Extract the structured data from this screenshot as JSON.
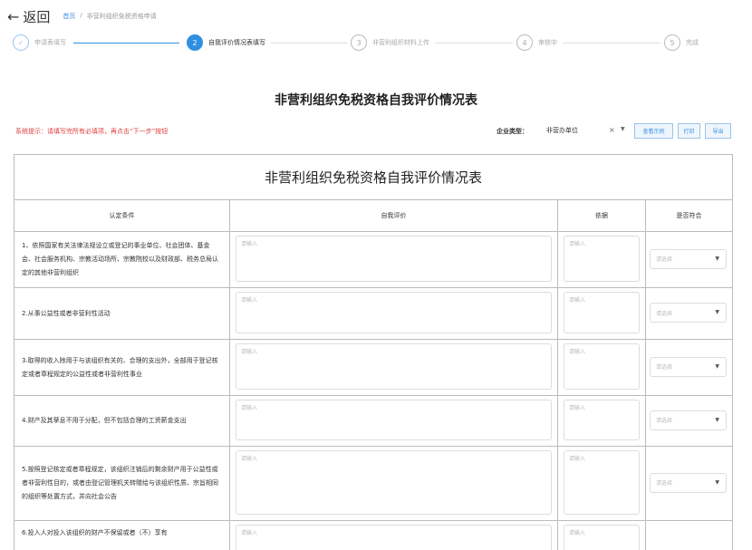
{
  "topbar": {
    "back_label": "返回",
    "breadcrumb": [
      "首页",
      "/",
      "非营利组织免税资格申请"
    ]
  },
  "steps": [
    {
      "num": "✓",
      "label": "申请表填写",
      "state": "done"
    },
    {
      "num": "2",
      "label": "自我评价情况表填写",
      "state": "active"
    },
    {
      "num": "3",
      "label": "非营利组织材料上传",
      "state": "todo"
    },
    {
      "num": "4",
      "label": "审核中",
      "state": "todo"
    },
    {
      "num": "5",
      "label": "完成",
      "state": "todo"
    }
  ],
  "page_title": "非营利组织免税资格自我评价情况表",
  "toolbar": {
    "hint": "系统提示：请填写完所有必填项，再点击“下一步”按钮",
    "type_label": "企业类型：",
    "type_value": "非营办单位",
    "btn_sample": "查看示例",
    "btn_print": "打印",
    "btn_export": "导出"
  },
  "table": {
    "title": "非营利组织免税资格自我评价情况表",
    "headers": [
      "认定条件",
      "自我评价",
      "依据",
      "是否符合"
    ],
    "placeholder": "请输入",
    "select_placeholder": "请选择",
    "rows": [
      {
        "condition": "1、依照国家有关法律法规设立或登记的事业单位、社会团体、基金会、社会服务机构、宗教活动场所、宗教院校以及财政部、税务总局认定的其他非营利组织"
      },
      {
        "condition": "2.从事公益性或者非营利性活动"
      },
      {
        "condition": "3.取得的收入除用于与该组织有关的、合理的支出外，全部用于登记核定或者章程规定的公益性或者非营利性事业"
      },
      {
        "condition": "4.财产及其孳息不用于分配，但不包括合理的工资薪金支出"
      },
      {
        "condition": "5.按照登记核定或者章程规定，该组织注销后的剩余财产用于公益性或者非营利性目的，或者由登记管理机关转赠给与该组织性质、宗旨相同的组织等处置方式，并向社会公告"
      },
      {
        "condition": "6.投入人对投入该组织的财产不保留或者（不）享有"
      }
    ]
  }
}
